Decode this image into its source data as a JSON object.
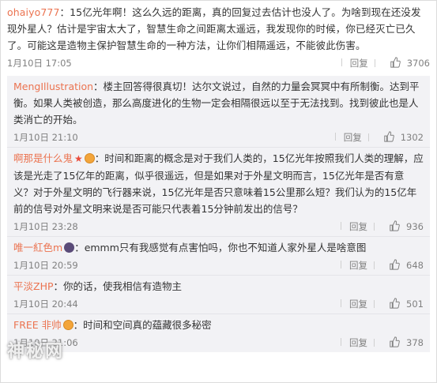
{
  "top_comment": {
    "user": "ohaiyo777",
    "text": "：15亿光年啊！这么久远的距离，真的回复过去估计也没人了。为啥到现在还没发现外星人？估计是宇宙太大了，智慧生命之间距离太遥远，我发现你的时候，你已经灭亡已久了。可能这是造物主保护智慧生命的一种方法，让你们相隔遥远，不能彼此伤害。",
    "time": "1月10日 17:05",
    "reply_label": "回复",
    "likes": "3706"
  },
  "replies": [
    {
      "user": "MengIllustration",
      "text": "：楼主回答得很真切！达尔文说过，自然的力量会冥冥中有所制衡。达到平衡。如果人类被创造，那么高度进化的生物一定会相隔很远以至于无法找到。找到彼此也是人类消亡的开始。",
      "time": "1月10日 21:10",
      "reply_label": "回复",
      "likes": "1302"
    },
    {
      "user": "啊那是什么鬼",
      "star": "★",
      "text": "：时间和距离的概念是对于我们人类的，15亿光年按照我们人类的理解，应该是光走了15亿年的距离，似乎很遥远，但是如果对于外星文明而言，15亿光年是否有意义？对于外星文明的飞行器来说，15亿光年是否只意味着15公里那么短？我们认为的15亿年前的信号对外星文明来说是否可能只代表着15分钟前发出的信号？",
      "time": "1月10日 23:28",
      "reply_label": "回复",
      "likes": "936"
    },
    {
      "user": "唯一紅色m",
      "text": "：emmm只有我感觉有点害怕吗，你也不知道人家外星人是啥意图",
      "time": "1月10日 20:59",
      "reply_label": "回复",
      "likes": "648"
    },
    {
      "user": "平淡ZHP",
      "text": "：你的话，使我相信有造物主",
      "time": "1月10日 20:44",
      "reply_label": "回复",
      "likes": "501"
    },
    {
      "user": "FREE 非帅",
      "text": "：时间和空间真的蕴藏很多秘密",
      "time": "1月10日 21:06",
      "reply_label": "回复",
      "likes": "378"
    }
  ],
  "watermark": "神秘网",
  "colors": {
    "username": "#eb7350",
    "reply_bg": "#f2f2f5",
    "meta": "#808080"
  }
}
